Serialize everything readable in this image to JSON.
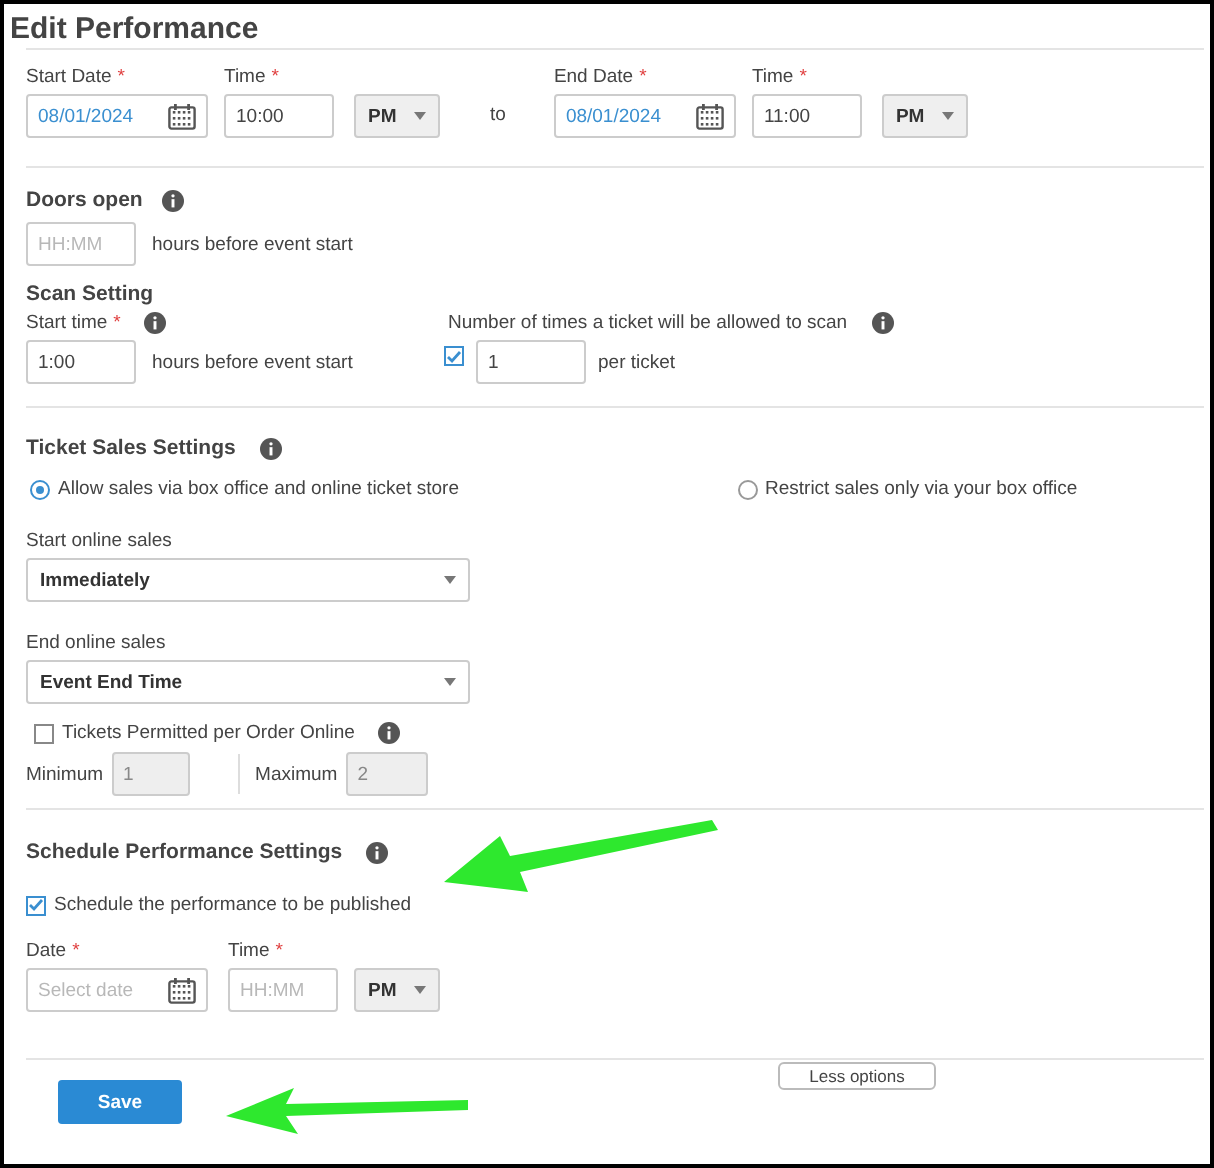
{
  "title": "Edit Performance",
  "date_times": [
    {
      "date_label": {
        "text": "Start Date",
        "mark": "*"
      },
      "date": "08/01/2024",
      "time_label": {
        "text": "Time",
        "mark": "*"
      },
      "time": "10:00",
      "meridiem": "PM"
    },
    {
      "date_label": {
        "text": "End Date",
        "mark": "*"
      },
      "date": "08/01/2024",
      "time_label": {
        "text": "Time",
        "mark": "*"
      },
      "time": "11:00",
      "meridiem": "PM"
    }
  ],
  "separator": "to",
  "doors_open": {
    "title": "Doors open",
    "placeholder": "HH:MM",
    "suffix": "hours before event start"
  },
  "scan": {
    "title": "Scan Setting",
    "start_label": {
      "text": "Start time",
      "mark": "*"
    },
    "start_value": "1:00",
    "suffix": "hours before event start",
    "count_label": "Number of times a ticket will be allowed to scan",
    "count_checked": true,
    "count_value": "1",
    "count_suffix": "per ticket"
  },
  "ticket_sales": {
    "title": "Ticket Sales Settings",
    "options": [
      {
        "label": "Allow sales via box office and online ticket store",
        "selected": true
      },
      {
        "label": "Restrict sales only via your box office",
        "selected": false
      }
    ],
    "start_label": "Start online sales",
    "start_value": "Immediately",
    "end_label": "End online sales",
    "end_value": "Event End Time",
    "limit": {
      "label": "Tickets Permitted per Order Online",
      "checked": false
    },
    "minimum": {
      "label": "Minimum",
      "value": "1",
      "disabled": true
    },
    "maximum": {
      "label": "Maximum",
      "value": "2",
      "disabled": true
    }
  },
  "schedule": {
    "title": "Schedule Performance Settings",
    "publish": {
      "label": "Schedule the performance to be published",
      "checked": true
    },
    "date_label": {
      "text": "Date",
      "mark": "*"
    },
    "date_placeholder": "Select date",
    "time_label": {
      "text": "Time",
      "mark": "*"
    },
    "time_placeholder": "HH:MM",
    "meridiem": "PM"
  },
  "footer": {
    "save": "Save",
    "less_options": "Less options"
  }
}
